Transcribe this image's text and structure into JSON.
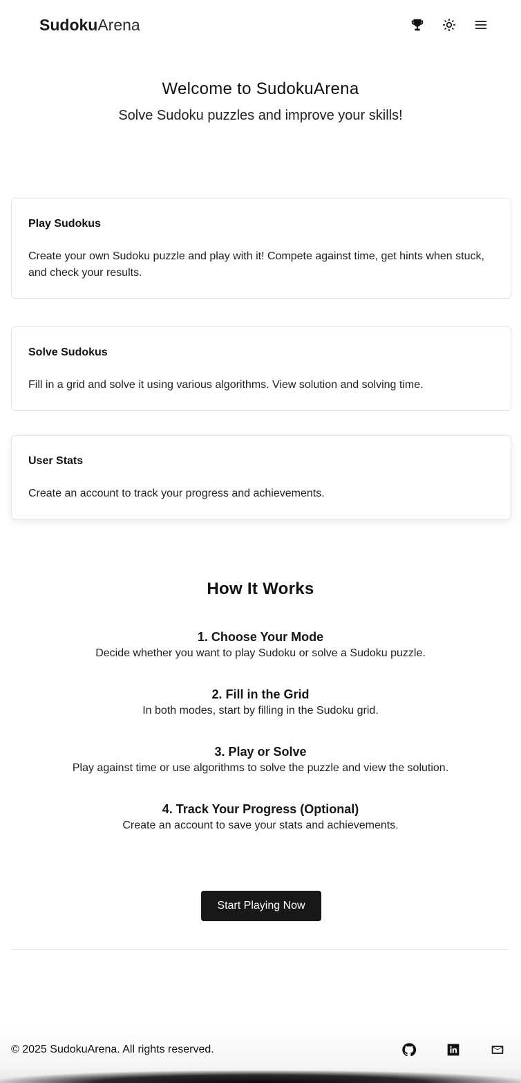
{
  "header": {
    "logo_bold": "Sudoku",
    "logo_light": "Arena",
    "icons": [
      "trophy-icon",
      "sun-icon",
      "menu-icon"
    ]
  },
  "hero": {
    "title": "Welcome to SudokuArena",
    "subtitle": "Solve Sudoku puzzles and improve your skills!"
  },
  "cards": [
    {
      "title": "Play Sudokus",
      "description": "Create your own Sudoku puzzle and play with it! Compete against time, get hints when stuck, and check your results."
    },
    {
      "title": "Solve Sudokus",
      "description": "Fill in a grid and solve it using various algorithms. View solution and solving time."
    },
    {
      "title": "User Stats",
      "description": "Create an account to track your progress and achievements."
    }
  ],
  "how_it_works": {
    "title": "How It Works",
    "steps": [
      {
        "title": "1. Choose Your Mode",
        "description": "Decide whether you want to play Sudoku or solve a Sudoku puzzle."
      },
      {
        "title": "2. Fill in the Grid",
        "description": "In both modes, start by filling in the Sudoku grid."
      },
      {
        "title": "3. Play or Solve",
        "description": "Play against time or use algorithms to solve the puzzle and view the solution."
      },
      {
        "title": "4. Track Your Progress (Optional)",
        "description": "Create an account to save your stats and achievements."
      }
    ]
  },
  "cta": {
    "label": "Start Playing Now"
  },
  "footer": {
    "copyright": "© 2025 SudokuArena. All rights reserved.",
    "icons": [
      "github-icon",
      "linkedin-icon",
      "mail-icon"
    ]
  }
}
